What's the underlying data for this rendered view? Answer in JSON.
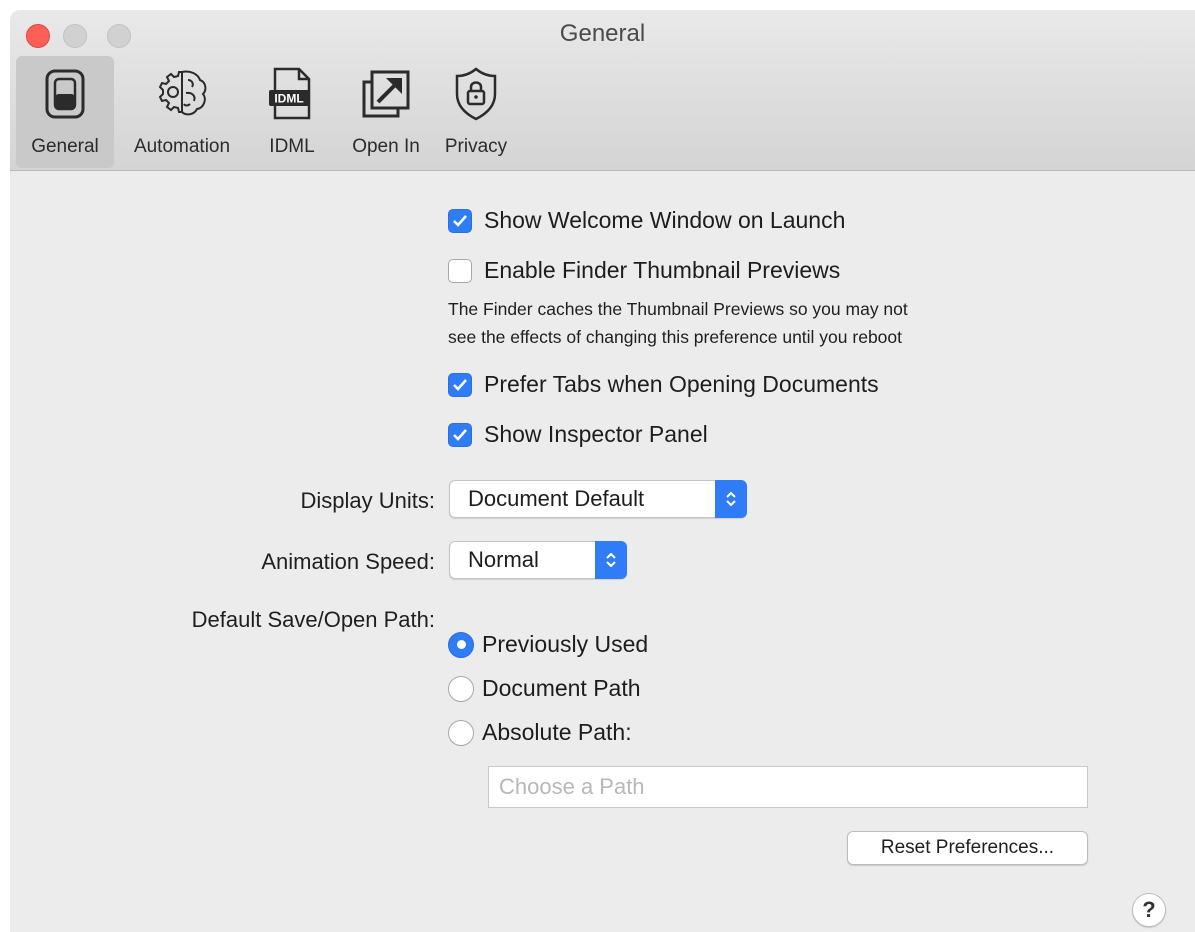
{
  "window": {
    "title": "General"
  },
  "toolbar": {
    "items": [
      {
        "label": "General",
        "icon": "switch-icon",
        "selected": true
      },
      {
        "label": "Automation",
        "icon": "brain-gear-icon",
        "selected": false
      },
      {
        "label": "IDML",
        "icon": "idml-file-icon",
        "selected": false
      },
      {
        "label": "Open In",
        "icon": "open-in-arrow-icon",
        "selected": false
      },
      {
        "label": "Privacy",
        "icon": "shield-lock-icon",
        "selected": false
      }
    ]
  },
  "settings": {
    "show_welcome": {
      "label": "Show Welcome Window on Launch",
      "checked": true
    },
    "finder_thumbnails": {
      "label": "Enable Finder Thumbnail Previews",
      "checked": false,
      "note_line1": "The Finder caches the Thumbnail Previews so you may not",
      "note_line2": "see the effects of changing this preference until you reboot"
    },
    "prefer_tabs": {
      "label": "Prefer Tabs when Opening Documents",
      "checked": true
    },
    "show_inspector": {
      "label": "Show Inspector Panel",
      "checked": true
    },
    "display_units": {
      "label": "Display Units:",
      "value": "Document Default"
    },
    "animation_speed": {
      "label": "Animation Speed:",
      "value": "Normal"
    },
    "save_path": {
      "label": "Default Save/Open Path:",
      "options": [
        {
          "label": "Previously Used",
          "selected": true
        },
        {
          "label": "Document Path",
          "selected": false
        },
        {
          "label": "Absolute Path:",
          "selected": false
        }
      ],
      "path_placeholder": "Choose a Path",
      "path_value": ""
    },
    "reset_button": "Reset Preferences...",
    "help_button": "?"
  },
  "colors": {
    "accent": "#2f7cf6",
    "close": "#fe5f57"
  }
}
